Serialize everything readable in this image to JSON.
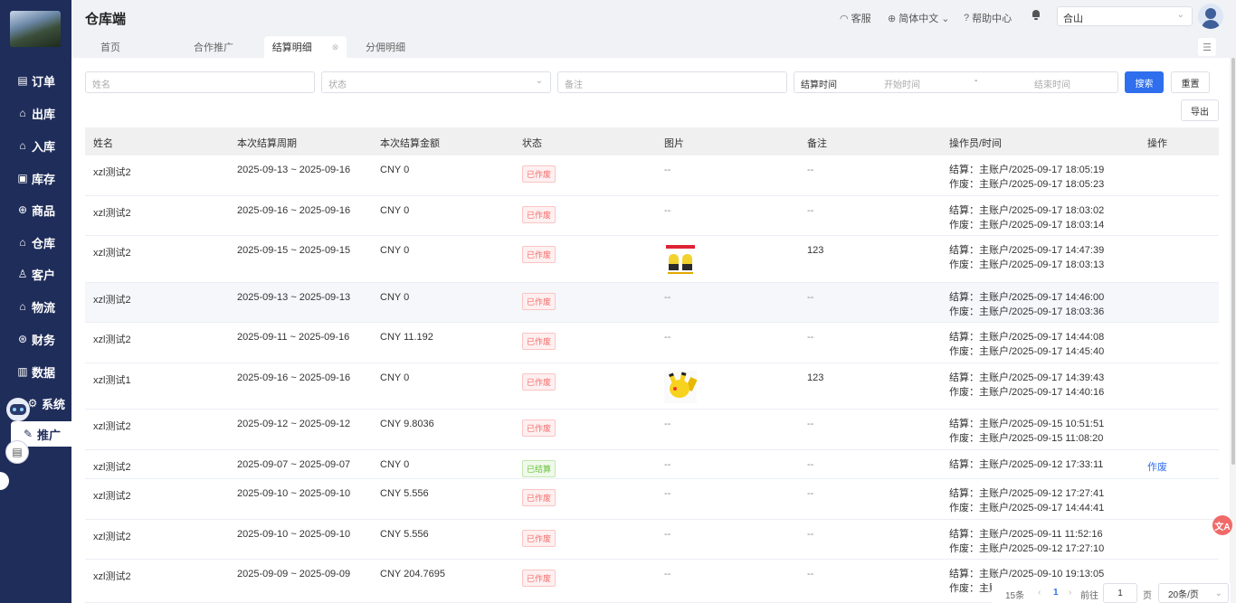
{
  "sidebar": {
    "items": [
      {
        "icon": "order-icon",
        "glyph": "▤",
        "label": "订单"
      },
      {
        "icon": "outbound-icon",
        "glyph": "⌂",
        "label": "出库"
      },
      {
        "icon": "inbound-icon",
        "glyph": "⌂",
        "label": "入库"
      },
      {
        "icon": "inventory-icon",
        "glyph": "▣",
        "label": "库存"
      },
      {
        "icon": "product-icon",
        "glyph": "⊕",
        "label": "商品"
      },
      {
        "icon": "warehouse-icon",
        "glyph": "⌂",
        "label": "仓库"
      },
      {
        "icon": "customer-icon",
        "glyph": "♙",
        "label": "客户"
      },
      {
        "icon": "logistics-icon",
        "glyph": "⌂",
        "label": "物流"
      },
      {
        "icon": "finance-icon",
        "glyph": "⊛",
        "label": "财务"
      },
      {
        "icon": "data-icon",
        "glyph": "▥",
        "label": "数据"
      },
      {
        "icon": "system-icon",
        "glyph": "⚙",
        "label": "系统"
      },
      {
        "icon": "promotion-icon",
        "glyph": "✎",
        "label": "推广"
      }
    ]
  },
  "header": {
    "title": "仓库端",
    "service": "客服",
    "language": "简体中文",
    "help": "帮助中心",
    "warehouse": "合山"
  },
  "tabs": [
    {
      "label": "首页"
    },
    {
      "label": "合作推广"
    },
    {
      "label": "结算明细"
    },
    {
      "label": "分佣明细"
    }
  ],
  "filters": {
    "name_placeholder": "姓名",
    "status_placeholder": "状态",
    "remark_placeholder": "备注",
    "date_label": "结算时间",
    "start_placeholder": "开始时间",
    "dash": "-",
    "end_placeholder": "结束时间",
    "search": "搜索",
    "reset": "重置",
    "export": "导出"
  },
  "table": {
    "columns": [
      "姓名",
      "本次结算周期",
      "本次结算金额",
      "状态",
      "图片",
      "备注",
      "操作员/时间",
      "操作"
    ],
    "rows": [
      {
        "name": "xzl测试2",
        "period": "2025-09-13 ~ 2025-09-16",
        "amount": "CNY 0",
        "status": "已作废",
        "image": "--",
        "remark": "--",
        "op1": "结算：主账户/2025-09-17 18:05:19",
        "op2": "作废：主账户/2025-09-17 18:05:23",
        "action": ""
      },
      {
        "name": "xzl测试2",
        "period": "2025-09-16 ~ 2025-09-16",
        "amount": "CNY 0",
        "status": "已作废",
        "image": "--",
        "remark": "--",
        "op1": "结算：主账户/2025-09-17 18:03:02",
        "op2": "作废：主账户/2025-09-17 18:03:14",
        "action": ""
      },
      {
        "name": "xzl测试2",
        "period": "2025-09-15 ~ 2025-09-15",
        "amount": "CNY 0",
        "status": "已作废",
        "image": "",
        "remark": "123",
        "op1": "结算：主账户/2025-09-17 14:47:39",
        "op2": "作废：主账户/2025-09-17 18:03:13",
        "action": ""
      },
      {
        "name": "xzl测试2",
        "period": "2025-09-13 ~ 2025-09-13",
        "amount": "CNY 0",
        "status": "已作废",
        "image": "--",
        "remark": "--",
        "op1": "结算：主账户/2025-09-17 14:46:00",
        "op2": "作废：主账户/2025-09-17 18:03:36",
        "action": ""
      },
      {
        "name": "xzl测试2",
        "period": "2025-09-11 ~ 2025-09-16",
        "amount": "CNY 11.192",
        "status": "已作废",
        "image": "--",
        "remark": "--",
        "op1": "结算：主账户/2025-09-17 14:44:08",
        "op2": "作废：主账户/2025-09-17 14:45:40",
        "action": ""
      },
      {
        "name": "xzl测试1",
        "period": "2025-09-16 ~ 2025-09-16",
        "amount": "CNY 0",
        "status": "已作废",
        "image": "",
        "remark": "123",
        "op1": "结算：主账户/2025-09-17 14:39:43",
        "op2": "作废：主账户/2025-09-17 14:40:16",
        "action": ""
      },
      {
        "name": "xzl测试2",
        "period": "2025-09-12 ~ 2025-09-12",
        "amount": "CNY 9.8036",
        "status": "已作废",
        "image": "--",
        "remark": "--",
        "op1": "结算：主账户/2025-09-15 10:51:51",
        "op2": "作废：主账户/2025-09-15 11:08:20",
        "action": ""
      },
      {
        "name": "xzl测试2",
        "period": "2025-09-07 ~ 2025-09-07",
        "amount": "CNY 0",
        "status": "已结算",
        "image": "--",
        "remark": "--",
        "op1": "结算：主账户/2025-09-12 17:33:11",
        "op2": "",
        "action": "作废"
      },
      {
        "name": "xzl测试2",
        "period": "2025-09-10 ~ 2025-09-10",
        "amount": "CNY 5.556",
        "status": "已作废",
        "image": "--",
        "remark": "--",
        "op1": "结算：主账户/2025-09-12 17:27:41",
        "op2": "作废：主账户/2025-09-17 14:44:41",
        "action": ""
      },
      {
        "name": "xzl测试2",
        "period": "2025-09-10 ~ 2025-09-10",
        "amount": "CNY 5.556",
        "status": "已作废",
        "image": "--",
        "remark": "--",
        "op1": "结算：主账户/2025-09-11 11:52:16",
        "op2": "作废：主账户/2025-09-12 17:27:10",
        "action": ""
      },
      {
        "name": "xzl测试2",
        "period": "2025-09-09 ~ 2025-09-09",
        "amount": "CNY 204.7695",
        "status": "已作废",
        "image": "--",
        "remark": "--",
        "op1": "结算：主账户/2025-09-10 19:13:05",
        "op2": "作废：主账",
        "action": ""
      }
    ]
  },
  "pagination": {
    "total": "15条",
    "prev": "‹",
    "current": "1",
    "next": "›",
    "goto": "前往",
    "page_input": "1",
    "page_unit": "页",
    "page_size": "20条/页"
  },
  "floating": {
    "translate": "文A"
  },
  "colors": {
    "sidebar_bg": "#1f2d5a",
    "primary": "#2f6fed",
    "void": "#f56c6c",
    "settled": "#67c23a"
  }
}
